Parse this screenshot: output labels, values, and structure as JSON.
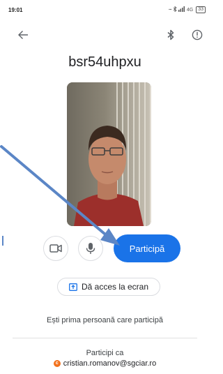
{
  "status_bar": {
    "time": "19:01",
    "network": "4G",
    "battery": "33"
  },
  "app_bar": {
    "back_icon": "arrow-back-icon",
    "bluetooth_icon": "bluetooth-icon",
    "info_icon": "info-icon"
  },
  "meeting": {
    "code": "bsr54uhpxu"
  },
  "controls": {
    "camera_icon": "videocam-icon",
    "mic_icon": "microphone-icon",
    "join_label": "Participă"
  },
  "present": {
    "label": "Dă acces la ecran",
    "icon": "present-screen-icon"
  },
  "status_message": "Ești prima persoană care participă",
  "account": {
    "joining_as_label": "Participi ca",
    "avatar_letter": "c",
    "email": "cristian.romanov@sgciar.ro"
  },
  "colors": {
    "accent": "#1a73e8",
    "avatar": "#f2711c",
    "annotation": "#5b86c6"
  }
}
